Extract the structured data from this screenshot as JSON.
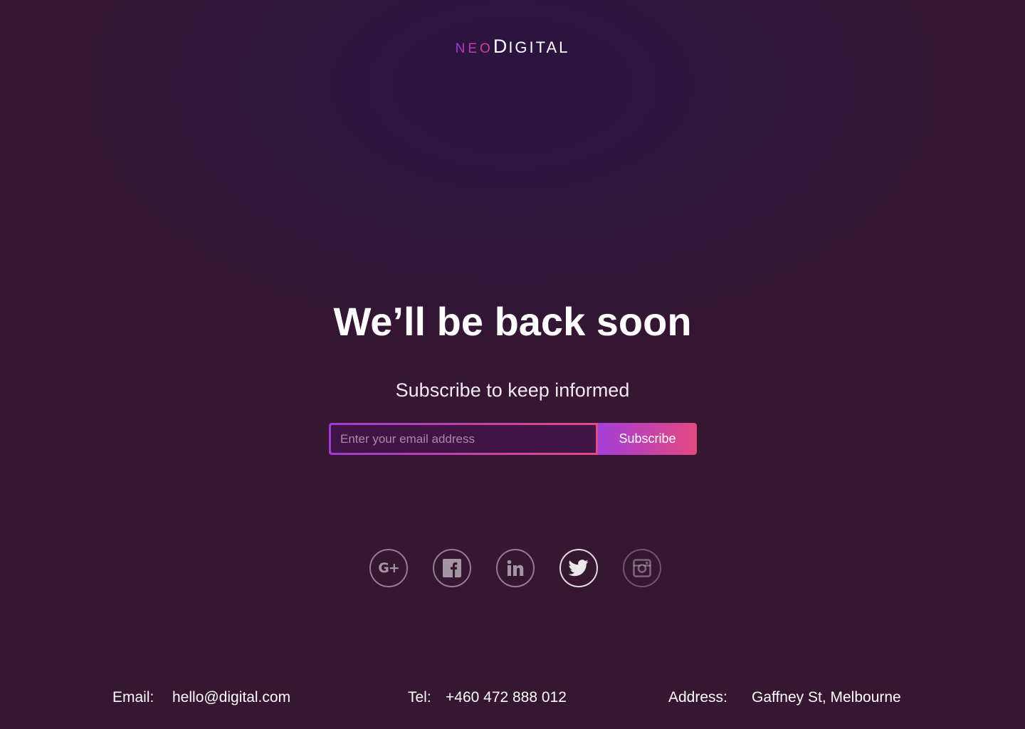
{
  "brand": {
    "logo_prefix": "NEO",
    "logo_initial": "D",
    "logo_rest": "IGITAL"
  },
  "hero": {
    "headline": "We’ll be back soon",
    "subheadline": "Subscribe to keep informed"
  },
  "subscribe": {
    "email_placeholder": "Enter your email address",
    "email_value": "",
    "button_label": "Subscribe"
  },
  "socials": [
    {
      "name": "google-plus-icon",
      "label": "G+"
    },
    {
      "name": "facebook-icon"
    },
    {
      "name": "linkedin-icon"
    },
    {
      "name": "twitter-icon"
    },
    {
      "name": "instagram-icon"
    }
  ],
  "footer": {
    "email_label": "Email:",
    "email_value": "hello@digital.com",
    "tel_label": "Tel:",
    "tel_value": "+460 472 888 012",
    "address_label": "Address:",
    "address_value": "Gaffney St, Melbourne"
  },
  "colors": {
    "background": "#361631",
    "accent_start": "#a53ed8",
    "accent_end": "#e3487f"
  }
}
